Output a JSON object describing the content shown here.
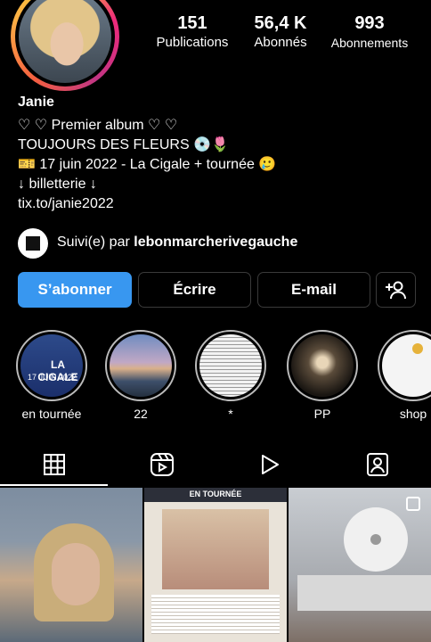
{
  "profile": {
    "stats": [
      {
        "value": "151",
        "label": "Publications"
      },
      {
        "value": "56,4 K",
        "label": "Abonnés"
      },
      {
        "value": "993",
        "label": "Abonnements"
      }
    ],
    "name": "Janie",
    "bio": [
      "♡ ♡ Premier album ♡ ♡",
      "TOUJOURS DES FLEURS 💿🌷",
      "🎫 17 juin 2022 - La Cigale + tournée 🥲",
      "↓ billetterie ↓",
      "tix.to/janie2022"
    ],
    "followed_by_prefix": "Suivi(e) par",
    "followed_by_user": "lebonmarcherivegauche"
  },
  "actions": {
    "subscribe": "S’abonner",
    "message": "Écrire",
    "email": "E-mail"
  },
  "highlights": [
    {
      "label": "en tournée",
      "text_line1": "LA CIGALE",
      "text_line2": "17 JUIN 2022"
    },
    {
      "label": "22"
    },
    {
      "label": "*"
    },
    {
      "label": "PP"
    },
    {
      "label": "shop"
    }
  ],
  "grid": {
    "post2_header": "EN TOURNÉE"
  },
  "colors": {
    "accent": "#3897f0",
    "background": "#000000"
  }
}
